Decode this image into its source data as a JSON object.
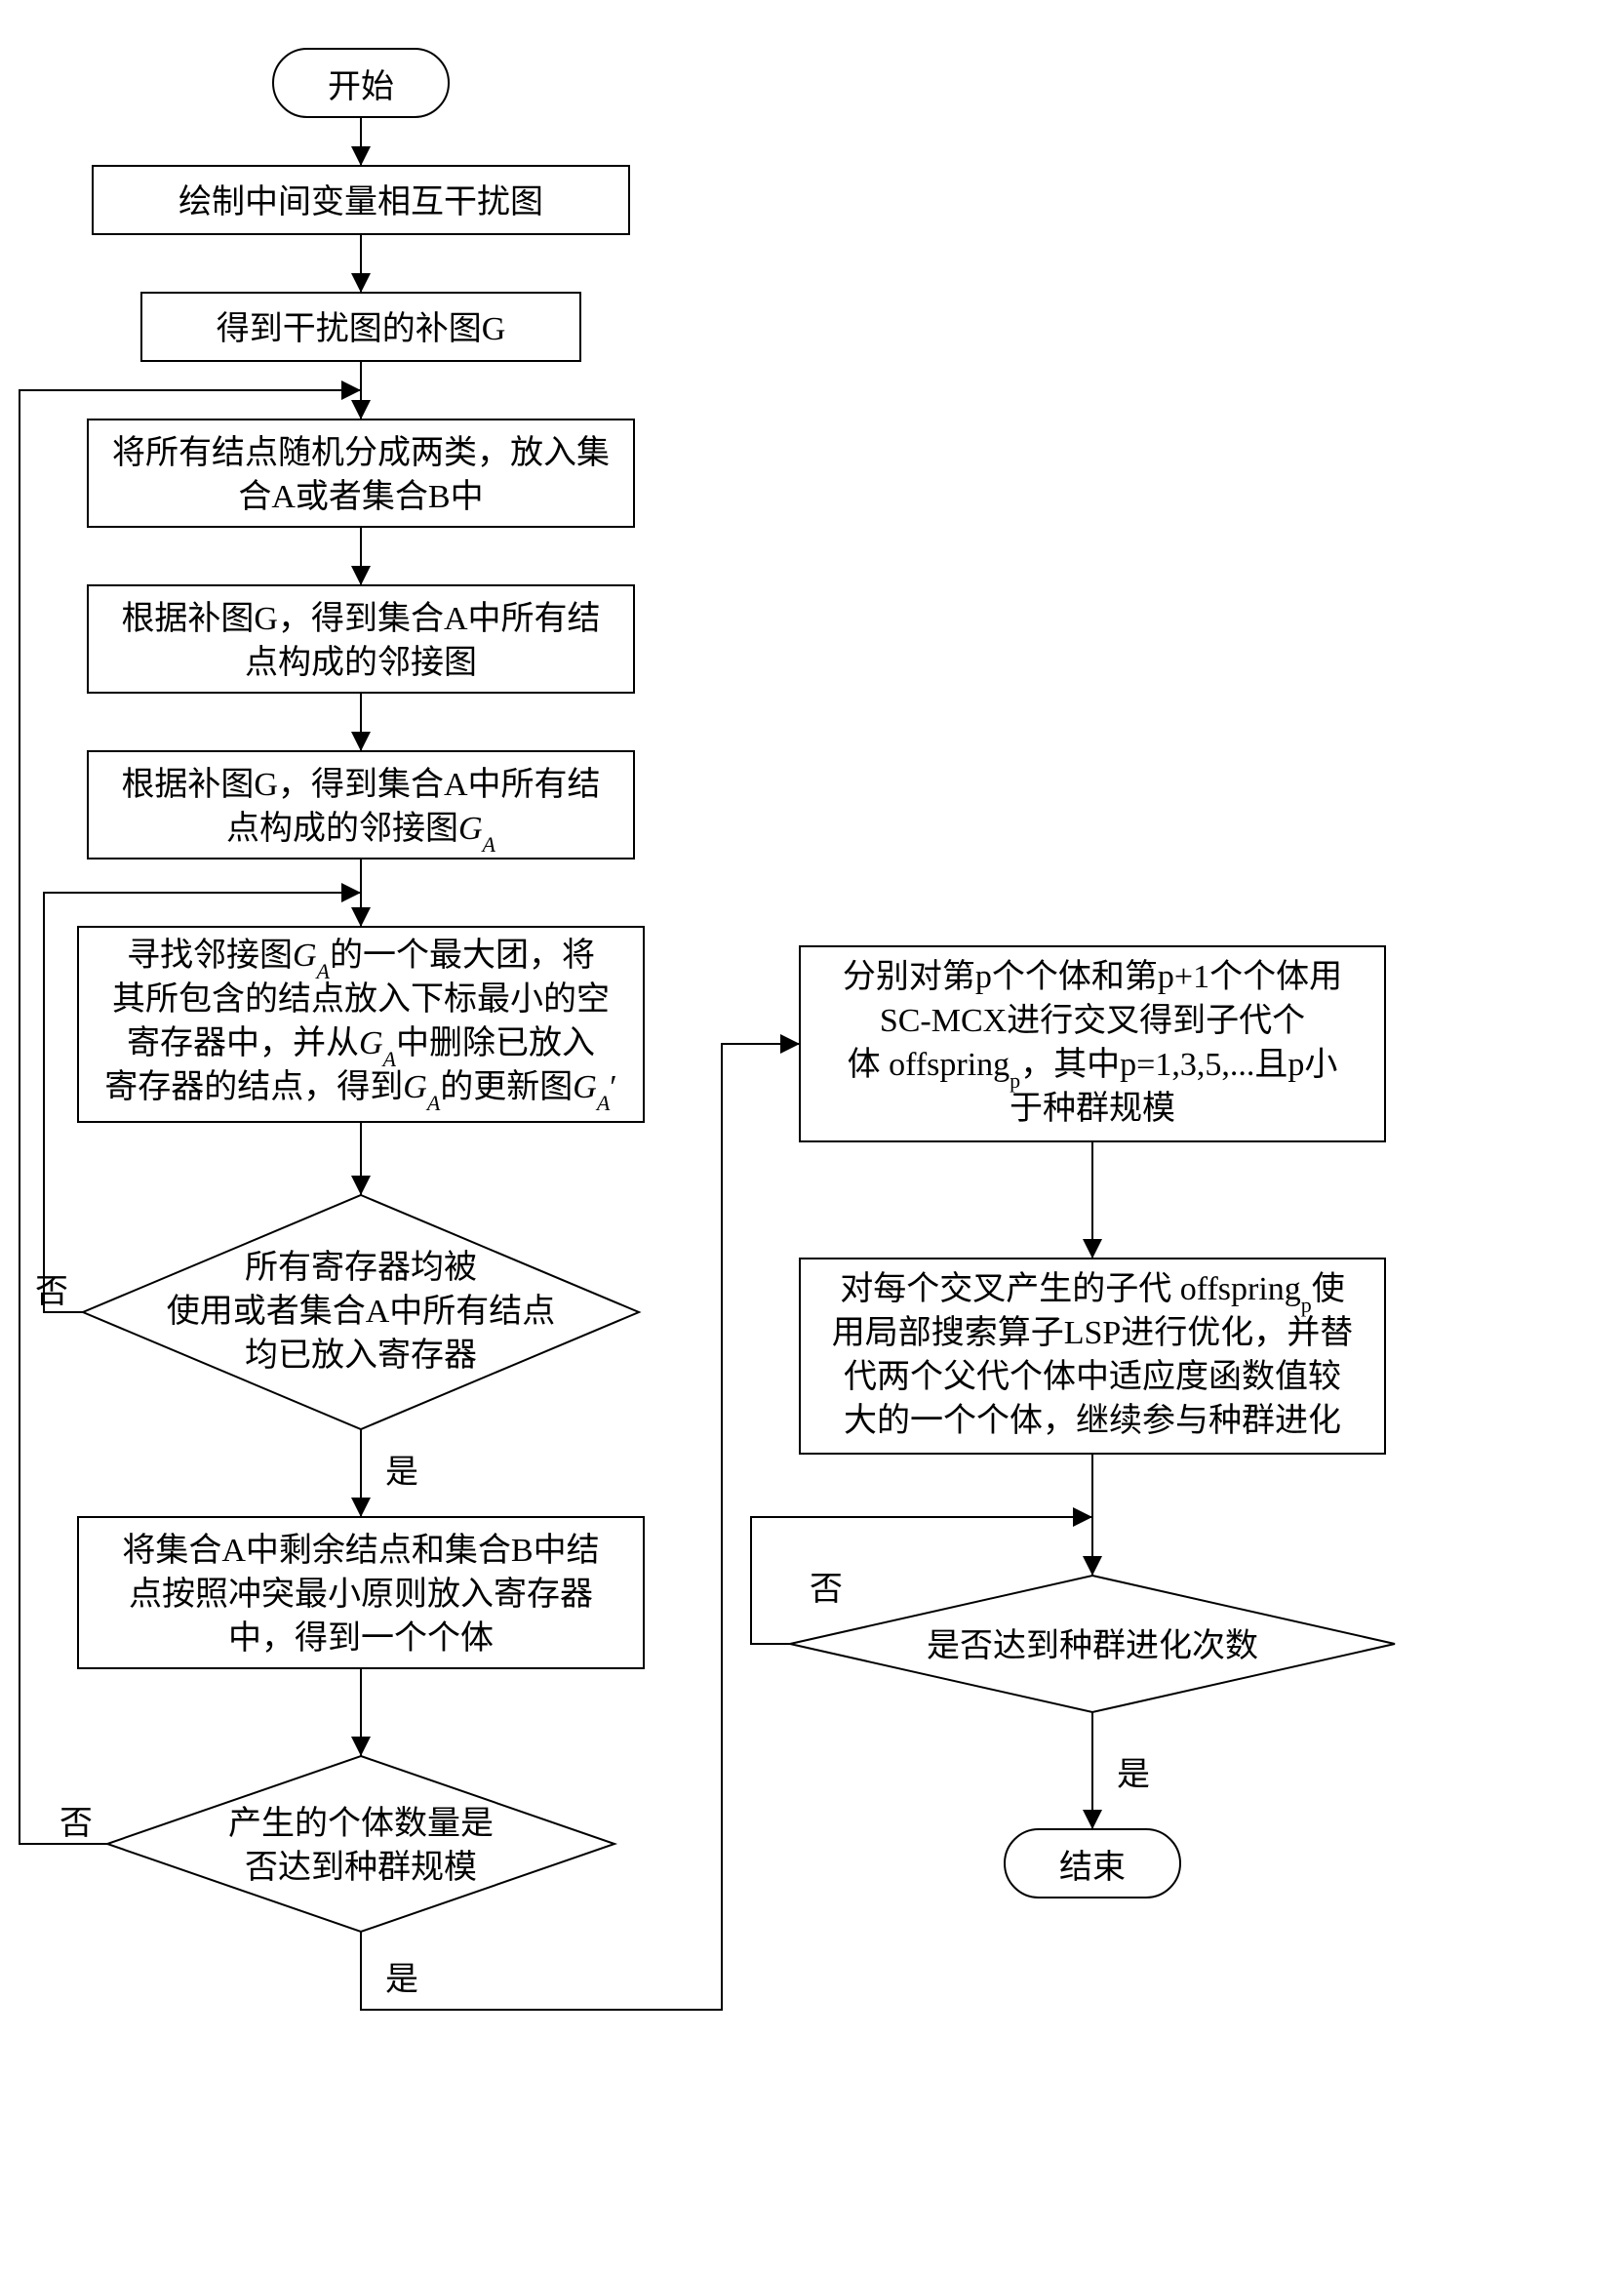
{
  "nodes": {
    "start": "开始",
    "n1": "绘制中间变量相互干扰图",
    "n2": "得到干扰图的补图G",
    "n3_l1": "将所有结点随机分成两类，放入集",
    "n3_l2": "合A或者集合B中",
    "n4_l1": "根据补图G，得到集合A中所有结",
    "n4_l2": "点构成的邻接图",
    "n5_l1": "根据补图G，得到集合A中所有结",
    "n5_l2_prefix": "点构成的邻接图",
    "n5_l2_ga": "G",
    "n5_l2_a": "A",
    "n6_l1_a": "寻找邻接图",
    "n6_l1_b": "G",
    "n6_l1_bsub": "A",
    "n6_l1_c": "的一个最大团，将",
    "n6_l2": "其所包含的结点放入下标最小的空",
    "n6_l3_a": "寄存器中，并从",
    "n6_l3_b": "G",
    "n6_l3_bsub": "A",
    "n6_l3_c": "中删除已放入",
    "n6_l4_a": "寄存器的结点，得到",
    "n6_l4_b": "G",
    "n6_l4_bsub": "A",
    "n6_l4_c": "的更新图",
    "n6_l4_d": "G",
    "n6_l4_dsub": "A",
    "n6_l4_e": "′",
    "d1_l1": "所有寄存器均被",
    "d1_l2": "使用或者集合A中所有结点",
    "d1_l3": "均已放入寄存器",
    "n7_l1": "将集合A中剩余结点和集合B中结",
    "n7_l2": "点按照冲突最小原则放入寄存器",
    "n7_l3": "中，得到一个个体",
    "d2_l1": "产生的个体数量是",
    "d2_l2": "否达到种群规模",
    "n8_l1": "分别对第p个个体和第p+1个个体用",
    "n8_l2": "SC-MCX进行交叉得到子代个",
    "n8_l3_a": "体 offspring",
    "n8_l3_sub": "p",
    "n8_l3_b": "，其中p=1,3,5,...且p小",
    "n8_l4": "于种群规模",
    "n9_l1_a": "对每个交叉产生的子代 offspring",
    "n9_l1_sub": "p",
    "n9_l1_b": "使",
    "n9_l2": "用局部搜索算子LSP进行优化，并替",
    "n9_l3": "代两个父代个体中适应度函数值较",
    "n9_l4": "大的一个个体，继续参与种群进化",
    "d3": "是否达到种群进化次数",
    "end": "结束"
  },
  "labels": {
    "yes": "是",
    "no": "否"
  }
}
